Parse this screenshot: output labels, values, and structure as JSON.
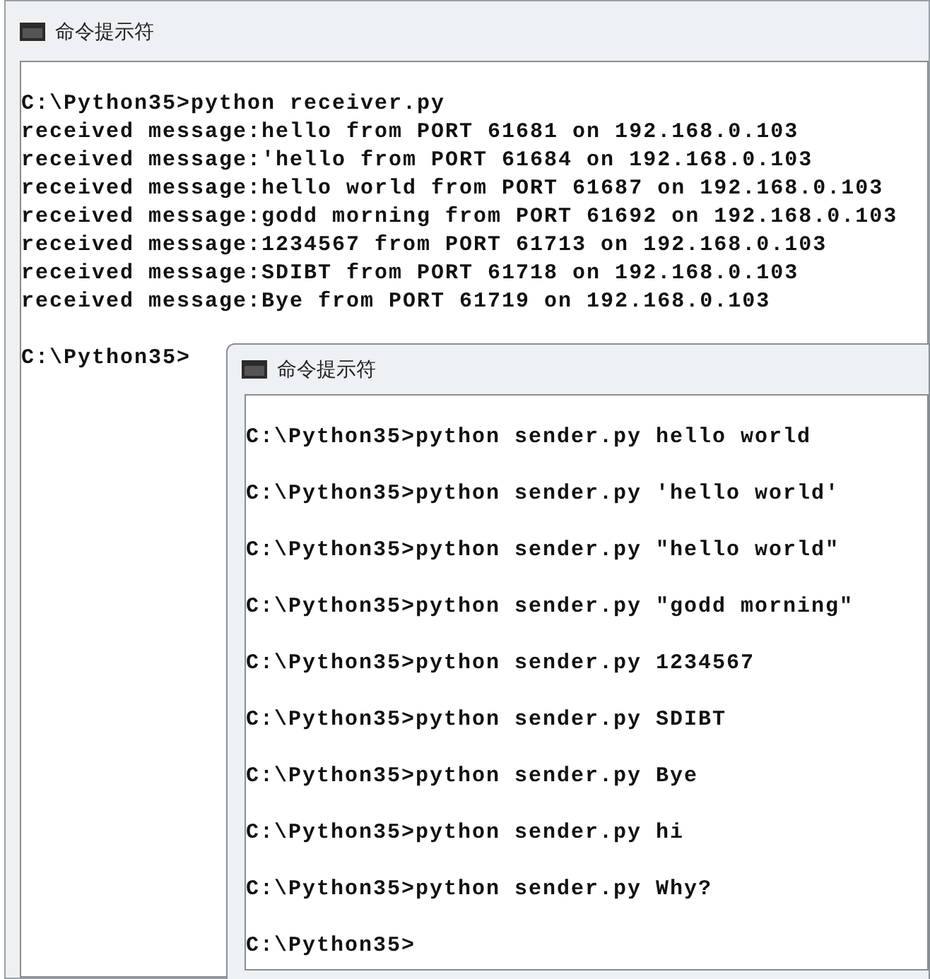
{
  "windows": [
    {
      "title": "命令提示符",
      "blocks": [
        [
          "C:\\Python35>python receiver.py",
          "received message:hello from PORT 61681 on 192.168.0.103",
          "received message:'hello from PORT 61684 on 192.168.0.103",
          "received message:hello world from PORT 61687 on 192.168.0.103",
          "received message:godd morning from PORT 61692 on 192.168.0.103",
          "received message:1234567 from PORT 61713 on 192.168.0.103",
          "received message:SDIBT from PORT 61718 on 192.168.0.103",
          "received message:Bye from PORT 61719 on 192.168.0.103"
        ],
        [
          "C:\\Python35>"
        ]
      ]
    },
    {
      "title": "命令提示符",
      "blocks": [
        [
          "C:\\Python35>python sender.py hello world"
        ],
        [
          "C:\\Python35>python sender.py 'hello world'"
        ],
        [
          "C:\\Python35>python sender.py \"hello world\""
        ],
        [
          "C:\\Python35>python sender.py \"godd morning\""
        ],
        [
          "C:\\Python35>python sender.py 1234567"
        ],
        [
          "C:\\Python35>python sender.py SDIBT"
        ],
        [
          "C:\\Python35>python sender.py Bye"
        ],
        [
          "C:\\Python35>python sender.py hi"
        ],
        [
          "C:\\Python35>python sender.py Why?"
        ],
        [
          "C:\\Python35>"
        ]
      ]
    }
  ]
}
